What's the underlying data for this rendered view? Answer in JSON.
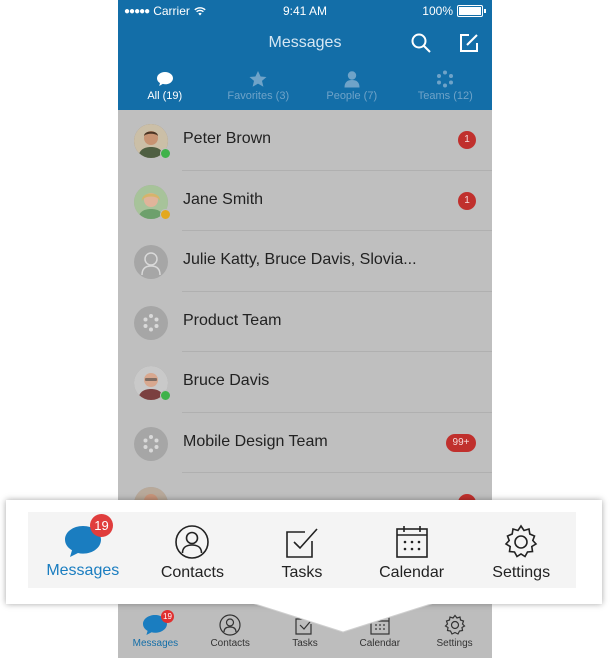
{
  "status_bar": {
    "carrier": "Carrier",
    "time": "9:41 AM",
    "battery": "100%"
  },
  "header": {
    "title": "Messages"
  },
  "tabs": [
    {
      "label": "All (19)",
      "icon": "chat-bubble-icon",
      "active": true
    },
    {
      "label": "Favorites (3)",
      "icon": "star-icon",
      "active": false
    },
    {
      "label": "People (7)",
      "icon": "person-icon",
      "active": false
    },
    {
      "label": "Teams (12)",
      "icon": "team-dots-icon",
      "active": false
    }
  ],
  "conversations": [
    {
      "name": "Peter Brown",
      "badge": "1",
      "presence": "online"
    },
    {
      "name": "Jane Smith",
      "badge": "1",
      "presence": "away"
    },
    {
      "name": "Julie Katty, Bruce Davis, Slovia...",
      "badge": "",
      "presence": ""
    },
    {
      "name": "Product Team",
      "badge": "",
      "presence": ""
    },
    {
      "name": "Bruce Davis",
      "badge": "",
      "presence": "online"
    },
    {
      "name": "Mobile Design Team",
      "badge": "99+",
      "presence": ""
    }
  ],
  "bottom_tabs": [
    {
      "label": "Messages",
      "badge": "19"
    },
    {
      "label": "Contacts"
    },
    {
      "label": "Tasks"
    },
    {
      "label": "Calendar"
    },
    {
      "label": "Settings"
    }
  ],
  "callout_tabs": [
    {
      "label": "Messages",
      "badge": "19"
    },
    {
      "label": "Contacts"
    },
    {
      "label": "Tasks"
    },
    {
      "label": "Calendar"
    },
    {
      "label": "Settings"
    }
  ],
  "colors": {
    "brand": "#136ea8",
    "badge_red": "#c0302d",
    "online": "#3fb24a",
    "away": "#e3a81f",
    "active_tab": "#1a7dc0"
  }
}
